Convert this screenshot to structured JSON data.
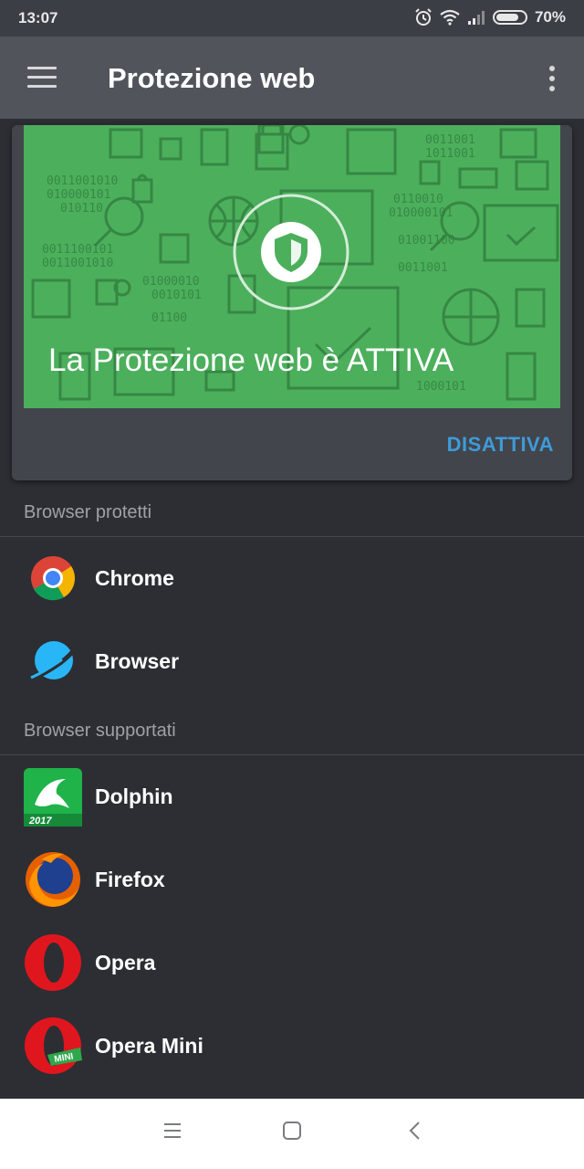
{
  "status_bar": {
    "time": "13:07",
    "battery": "70%",
    "icons": [
      "alarm-icon",
      "wifi-icon",
      "signal-icon",
      "battery-icon"
    ]
  },
  "app_bar": {
    "title": "Protezione web",
    "menu_icon": "hamburger-icon",
    "overflow_icon": "more-vert-icon"
  },
  "protection_card": {
    "status_text": "La Protezione web è ATTIVA",
    "action_label": "DISATTIVA",
    "banner_color": "#4caf5c",
    "action_color": "#3e9bd8",
    "emblem_icon": "shield-check-icon"
  },
  "protected_browsers": {
    "header": "Browser protetti",
    "items": [
      {
        "label": "Chrome",
        "icon": "chrome-icon"
      },
      {
        "label": "Browser",
        "icon": "mi-browser-icon"
      }
    ]
  },
  "supported_browsers": {
    "header": "Browser supportati",
    "items": [
      {
        "label": "Dolphin",
        "icon": "dolphin-icon",
        "badge": "2017"
      },
      {
        "label": "Firefox",
        "icon": "firefox-icon"
      },
      {
        "label": "Opera",
        "icon": "opera-icon"
      },
      {
        "label": "Opera Mini",
        "icon": "opera-mini-icon",
        "badge": "MINI"
      }
    ]
  },
  "nav_bar": {
    "buttons": [
      "recents-icon",
      "home-icon",
      "back-icon"
    ]
  }
}
